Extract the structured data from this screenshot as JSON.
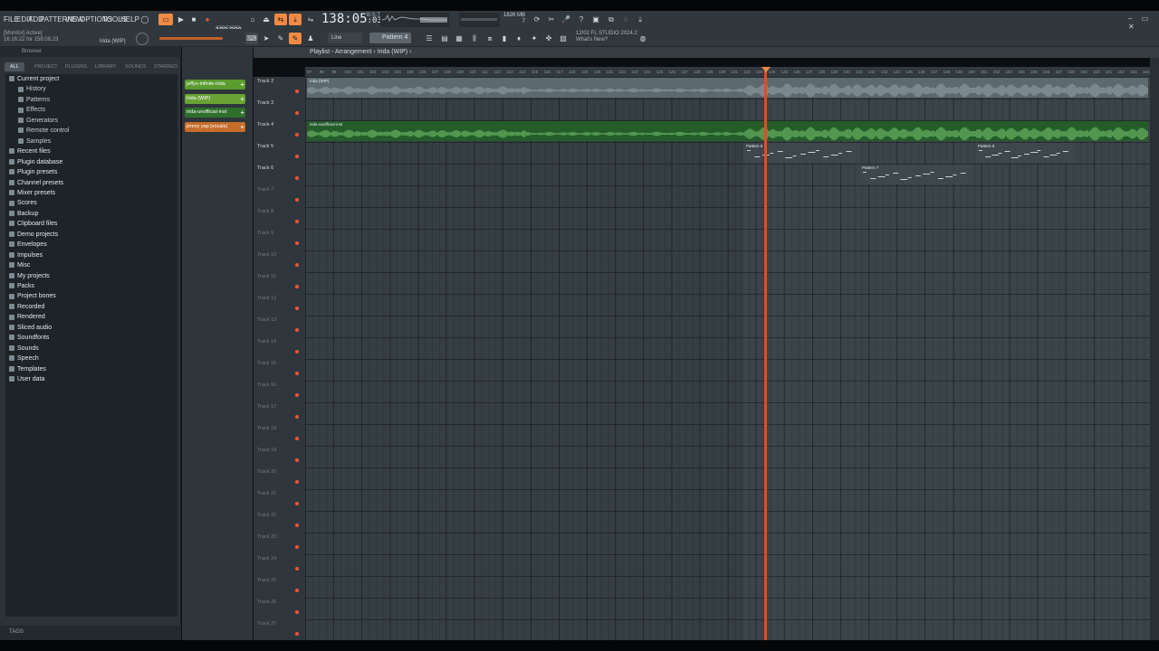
{
  "menu": [
    "FILE",
    "EDIT",
    "ADD",
    "PATTERNS",
    "VIEW",
    "OPTIONS",
    "TOOLS",
    "HELP"
  ],
  "transport": {
    "tempo": "180.000",
    "time": "138:05",
    "time_frac": "03",
    "time_unit": "B:S:T"
  },
  "memory": {
    "ram": "1826 MB",
    "cpu": "7"
  },
  "hint_left": {
    "line1": "[Monitor] Active]",
    "line2": "16:16:22 for 158:08.23",
    "project": "Irida (WIP)"
  },
  "toolbar": {
    "snap": "Line",
    "pattern": "Pattern 4"
  },
  "news": {
    "line1": "12/02 FL STUDIO 2024.2",
    "line2": "What's New?"
  },
  "browser": {
    "title": "Browser",
    "tabs": [
      "ALL",
      "PROJECT",
      "PLUGINS",
      "LIBRARY",
      "SOUNDS",
      "STARRED"
    ],
    "tags_label": "TAGS",
    "items": [
      {
        "label": "Current project",
        "level": 0
      },
      {
        "label": "History",
        "level": 1
      },
      {
        "label": "Patterns",
        "level": 1
      },
      {
        "label": "Effects",
        "level": 1
      },
      {
        "label": "Generators",
        "level": 1
      },
      {
        "label": "Remote control",
        "level": 1
      },
      {
        "label": "Samples",
        "level": 1
      },
      {
        "label": "Recent files",
        "level": 0
      },
      {
        "label": "Plugin database",
        "level": 0
      },
      {
        "label": "Plugin presets",
        "level": 0
      },
      {
        "label": "Channel presets",
        "level": 0
      },
      {
        "label": "Mixer presets",
        "level": 0
      },
      {
        "label": "Scores",
        "level": 0
      },
      {
        "label": "Backup",
        "level": 0
      },
      {
        "label": "Clipboard files",
        "level": 0
      },
      {
        "label": "Demo projects",
        "level": 0
      },
      {
        "label": "Envelopes",
        "level": 0
      },
      {
        "label": "Impulses",
        "level": 0
      },
      {
        "label": "Misc",
        "level": 0
      },
      {
        "label": "My projects",
        "level": 0
      },
      {
        "label": "Packs",
        "level": 0
      },
      {
        "label": "Project bones",
        "level": 0
      },
      {
        "label": "Recorded",
        "level": 0
      },
      {
        "label": "Rendered",
        "level": 0
      },
      {
        "label": "Sliced audio",
        "level": 0
      },
      {
        "label": "Soundfonts",
        "level": 0
      },
      {
        "label": "Sounds",
        "level": 0
      },
      {
        "label": "Speech",
        "level": 0
      },
      {
        "label": "Templates",
        "level": 0
      },
      {
        "label": "User data",
        "level": 0
      }
    ]
  },
  "picker": [
    {
      "label": "jeffys-infinite-irida",
      "color": "#5b9c2f"
    },
    {
      "label": "Irida (WIP)",
      "color": "#6aa336"
    },
    {
      "label": "irida-unofficial-inst",
      "color": "#2f6f2c"
    },
    {
      "label": "jimmy yap [vocals]",
      "color": "#c76d2a"
    }
  ],
  "playlist": {
    "breadcrumb": "Playlist - Arrangement › Irida (WIP) ›",
    "ruler_start": 97,
    "ruler_end": 164,
    "tracks": [
      "Track 2",
      "Track 3",
      "Track 4",
      "Track 5",
      "Track 6",
      "Track 7",
      "Track 8",
      "Track 9",
      "Track 10",
      "Track 11",
      "Track 12",
      "Track 13",
      "Track 14",
      "Track 15",
      "Track 16",
      "Track 17",
      "Track 18",
      "Track 19",
      "Track 20",
      "Track 21",
      "Track 22",
      "Track 23",
      "Track 24",
      "Track 25",
      "Track 26",
      "Track 27"
    ],
    "clips": [
      {
        "label": "Irida (WIP)",
        "track": 0,
        "type": "audio",
        "color": "#5c6a70"
      },
      {
        "label": "irida-unofficial-inst",
        "track": 2,
        "type": "audio",
        "color": "#245c2a"
      },
      {
        "label": "Pattern 5",
        "track": 3,
        "type": "pattern",
        "color": "#3d474c"
      },
      {
        "label": "Pattern 8",
        "track": 3,
        "type": "pattern",
        "color": "#3d474c"
      },
      {
        "label": "Pattern 7",
        "track": 4,
        "type": "pattern",
        "color": "#3d474c"
      }
    ]
  }
}
